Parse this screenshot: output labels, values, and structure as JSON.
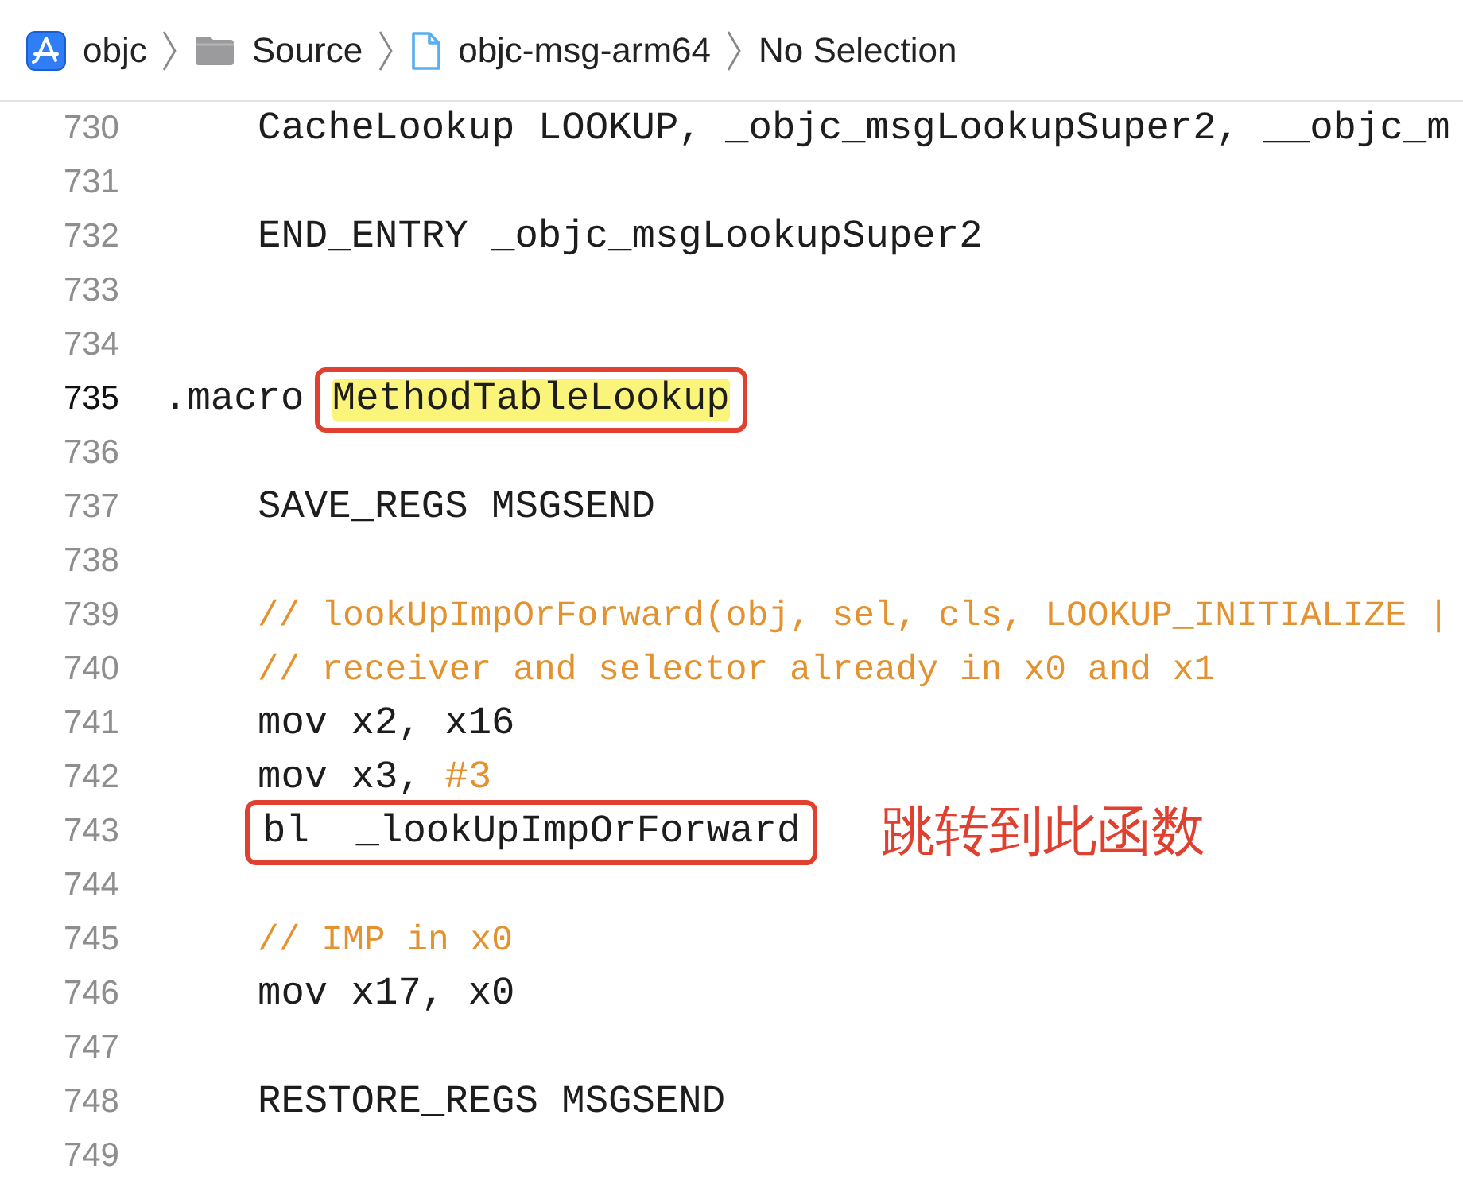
{
  "breadcrumbs": [
    {
      "label": "objc",
      "kind": "project"
    },
    {
      "label": "Source",
      "kind": "folder"
    },
    {
      "label": "objc-msg-arm64",
      "kind": "file"
    },
    {
      "label": "No Selection",
      "kind": "text"
    }
  ],
  "lines": [
    {
      "number": "730",
      "current": false,
      "indented": true,
      "segments": [
        {
          "text": "CacheLookup LOOKUP, _objc_msgLookupSuper2, __objc_m",
          "kind": "plain",
          "boxed": false
        }
      ]
    },
    {
      "number": "731",
      "current": false
    },
    {
      "number": "732",
      "current": false,
      "indented": true,
      "segments": [
        {
          "text": "END_ENTRY _objc_msgLookupSuper2",
          "kind": "plain",
          "boxed": false
        }
      ]
    },
    {
      "number": "733",
      "current": false
    },
    {
      "number": "734",
      "current": false
    },
    {
      "number": "735",
      "current": true,
      "indented": false,
      "segments": [
        {
          "text": ".macro",
          "kind": "plain",
          "boxed": false
        },
        {
          "text": "MethodTableLookup",
          "kind": "highlight",
          "boxed": true
        }
      ]
    },
    {
      "number": "736",
      "current": false
    },
    {
      "number": "737",
      "current": false,
      "indented": true,
      "segments": [
        {
          "text": "SAVE_REGS MSGSEND",
          "kind": "plain",
          "boxed": false
        }
      ]
    },
    {
      "number": "738",
      "current": false
    },
    {
      "number": "739",
      "current": false,
      "indented": true,
      "segments": [
        {
          "text": "// lookUpImpOrForward(obj, sel, cls, LOOKUP_INITIALIZE |",
          "kind": "comment",
          "boxed": false
        }
      ]
    },
    {
      "number": "740",
      "current": false,
      "indented": true,
      "segments": [
        {
          "text": "// receiver and selector already in x0 and x1",
          "kind": "comment",
          "boxed": false
        }
      ]
    },
    {
      "number": "741",
      "current": false,
      "indented": true,
      "segments": [
        {
          "text": "mov x2, x16",
          "kind": "plain",
          "boxed": false
        }
      ]
    },
    {
      "number": "742",
      "current": false,
      "indented": true,
      "segments": [
        {
          "text": "mov x3, ",
          "kind": "plain",
          "boxed": false
        },
        {
          "text": "#3",
          "kind": "number",
          "boxed": false
        }
      ]
    },
    {
      "number": "743",
      "current": false,
      "indented": true,
      "segments": [
        {
          "text": "bl  _lookUpImpOrForward",
          "kind": "plain",
          "boxed": true
        }
      ],
      "callout": "跳转到此函数"
    },
    {
      "number": "744",
      "current": false
    },
    {
      "number": "745",
      "current": false,
      "indented": true,
      "segments": [
        {
          "text": "// IMP in x0",
          "kind": "comment",
          "boxed": false
        }
      ]
    },
    {
      "number": "746",
      "current": false,
      "indented": true,
      "segments": [
        {
          "text": "mov x17, x0",
          "kind": "plain",
          "boxed": false
        }
      ]
    },
    {
      "number": "747",
      "current": false
    },
    {
      "number": "748",
      "current": false,
      "indented": true,
      "segments": [
        {
          "text": "RESTORE_REGS MSGSEND",
          "kind": "plain",
          "boxed": false
        }
      ]
    },
    {
      "number": "749",
      "current": false
    }
  ]
}
